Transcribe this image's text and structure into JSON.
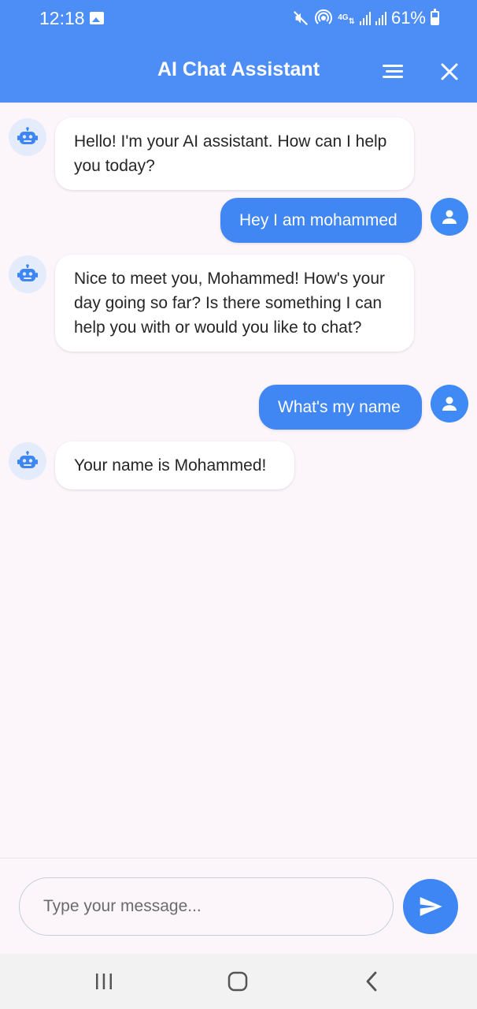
{
  "status_bar": {
    "time": "12:18",
    "network": "4G",
    "battery": "61%"
  },
  "app_bar": {
    "title": "AI Chat Assistant"
  },
  "messages": [
    {
      "sender": "bot",
      "text": "Hello! I'm your AI assistant. How can I help you today?"
    },
    {
      "sender": "user",
      "text": "Hey I am mohammed"
    },
    {
      "sender": "bot",
      "text": "Nice to meet you, Mohammed! How's your day going so far? Is there something I can help you with or would you like to chat?"
    },
    {
      "sender": "user",
      "text": "What's my name"
    },
    {
      "sender": "bot",
      "text": "Your name is Mohammed!"
    }
  ],
  "input": {
    "value": "",
    "placeholder": "Type your message..."
  },
  "colors": {
    "primary": "#4d8df6",
    "user_bubble": "#4087f3",
    "bot_bubble": "#ffffff",
    "background": "#fcf6fb",
    "bot_avatar_bg": "#e4ebfb"
  },
  "icons": {
    "bot_avatar": "robot-icon",
    "user_avatar": "person-icon",
    "menu": "menu-icon",
    "close": "close-icon",
    "send": "send-icon"
  }
}
